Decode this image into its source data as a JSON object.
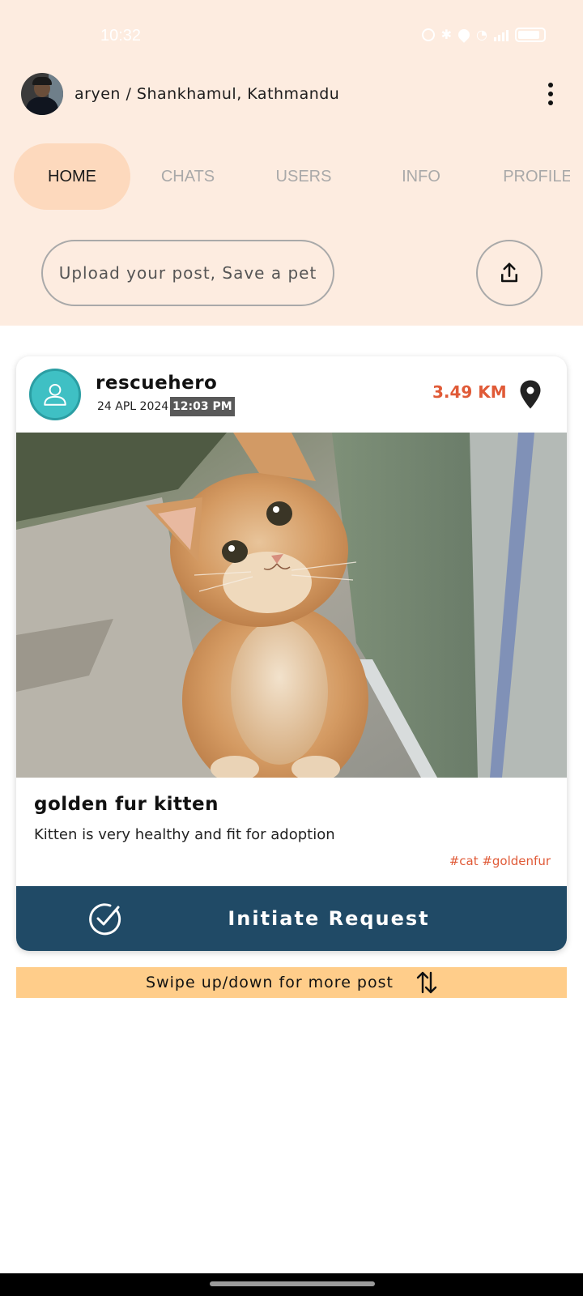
{
  "status_bar": {
    "time": "10:32"
  },
  "header": {
    "user_location": "aryen / Shankhamul, Kathmandu"
  },
  "tabs": [
    {
      "label": "HOME"
    },
    {
      "label": "CHATS"
    },
    {
      "label": "USERS"
    },
    {
      "label": "INFO"
    },
    {
      "label": "PROFILE"
    }
  ],
  "upload": {
    "placeholder": "Upload your post, Save a pet"
  },
  "post": {
    "username": "rescuehero",
    "date": "24 APL 2024",
    "time": "12:03 PM",
    "distance": "3.49 KM",
    "title": "golden fur kitten",
    "description": "Kitten is very healthy and fit for adoption",
    "tags": "#cat #goldenfur",
    "action_label": "Initiate Request"
  },
  "swipe_hint": "Swipe up/down for more post",
  "colors": {
    "top_bg": "#fdece0",
    "active_tab": "#fdd9bd",
    "accent_orange": "#e05a37",
    "button_navy": "#204a66",
    "swipe_bg": "#ffcd8a"
  }
}
